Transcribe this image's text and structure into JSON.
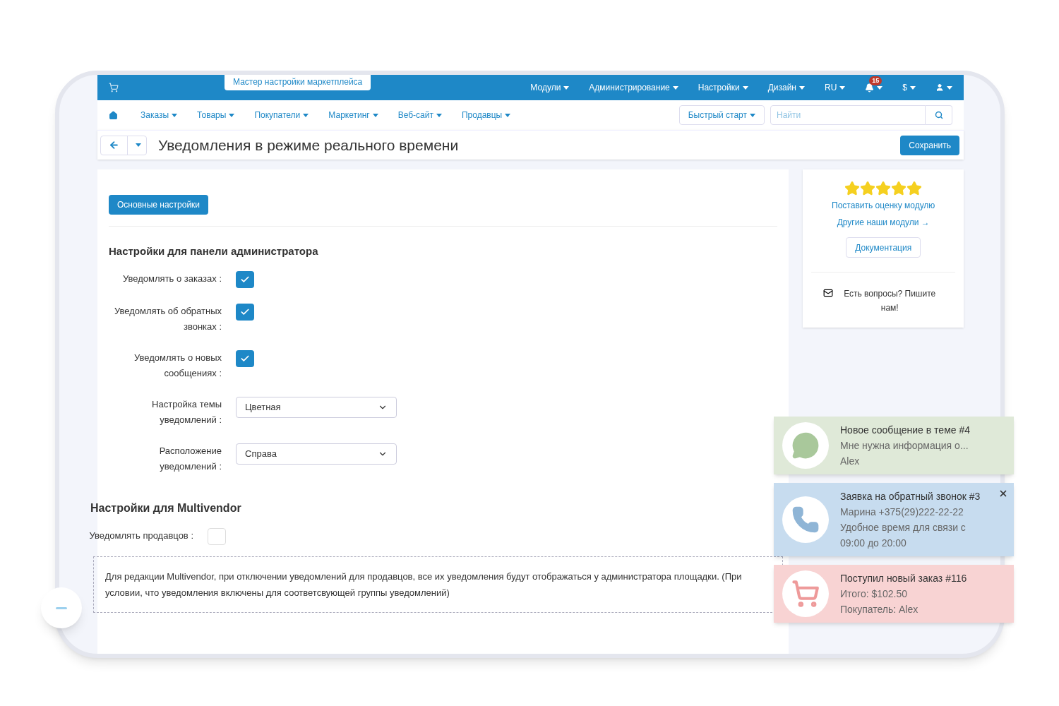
{
  "top_bar": {
    "wizard_button": "Мастер настройки маркетплейса",
    "menu": [
      "Модули",
      "Администрирование",
      "Настройки",
      "Дизайн",
      "RU"
    ],
    "notifications_count": "15",
    "currency": "$"
  },
  "nav": {
    "items": [
      "Заказы",
      "Товары",
      "Покупатели",
      "Маркетинг",
      "Веб-сайт",
      "Продавцы"
    ],
    "quick_start": "Быстрый старт",
    "search": {
      "placeholder": "Найти"
    }
  },
  "page": {
    "title": "Уведомления в режиме реального времени",
    "save_button": "Сохранить"
  },
  "tabs": [
    {
      "label": "Основные настройки",
      "selected": true
    }
  ],
  "admin_section": {
    "heading": "Настройки для панели администратора",
    "fields": [
      {
        "kind": "checkbox",
        "label": "Уведомлять о заказах :",
        "checked": true
      },
      {
        "kind": "checkbox",
        "label": "Уведомлять об обратных звонках :",
        "checked": true
      },
      {
        "kind": "checkbox",
        "label": "Уведомлять о новых сообщениях :",
        "checked": true
      },
      {
        "kind": "select",
        "label": "Настройка темы уведомлений :",
        "value": "Цветная"
      },
      {
        "kind": "select",
        "label": "Расположение уведомлений :",
        "value": "Справа"
      }
    ]
  },
  "multivendor_section": {
    "heading": "Настройки для Multivendor",
    "fields": [
      {
        "kind": "checkbox",
        "label": "Уведомлять продавцов :",
        "checked": false
      }
    ],
    "note": "Для редакции Multivendor, при отключении уведомлений для продавцов, все их уведомления будут отображаться у администратора площадки. (При условии, что уведомления включены для соответсвующей группы уведомлений)"
  },
  "sidebar": {
    "stars": 5,
    "rate_link": "Поставить оценку модулю",
    "other_link": "Другие наши модули →",
    "docs_button": "Документация",
    "contact": "Есть вопросы? Пишите нам!"
  },
  "toasts": [
    {
      "kind": "message",
      "color": "#dfe9d8",
      "title": "Новое сообщение в теме #4",
      "lines": [
        "Мне нужна информация о...",
        "Alex"
      ],
      "closable": false
    },
    {
      "kind": "callback",
      "color": "#c7dcef",
      "title": "Заявка на обратный звонок #3",
      "lines": [
        "Марина +375(29)222-22-22",
        "Удобное время для связи с 09:00 до 20:00"
      ],
      "closable": true
    },
    {
      "kind": "order",
      "color": "#f8d3d3",
      "title": "Поступил новый заказ #116",
      "lines": [
        "Итого: $102.50",
        "Покупатель: Alex"
      ],
      "closable": false
    }
  ]
}
